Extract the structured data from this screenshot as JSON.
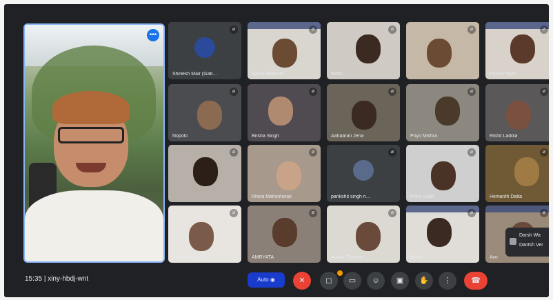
{
  "meeting": {
    "time": "15:35",
    "separator": "|",
    "code": "xiny-hbdj-wnt"
  },
  "speaker": {
    "name": "",
    "badge": "•••"
  },
  "tiles": [
    {
      "label": "Shiriesh Mair (Gab…",
      "type": "avatar",
      "avatar_color": "#2c4a9a",
      "bg": "#3c4043"
    },
    {
      "label": "Darsh Walunat",
      "type": "video",
      "bg": "#d9d6d0",
      "face": "#6b4b34",
      "banner": true
    },
    {
      "label": "ROIC",
      "type": "video",
      "bg": "#cfcac3",
      "face": "#3a2a22"
    },
    {
      "label": "",
      "type": "video",
      "bg": "#c6b8a6",
      "face": "#6b4b34"
    },
    {
      "label": "Prisha Tayal",
      "type": "video",
      "bg": "#d8d2cb",
      "face": "#5b3a2c",
      "banner": true
    },
    {
      "label": "Nopolo",
      "type": "video",
      "bg": "#4a4c4f",
      "face": "#8b6a52"
    },
    {
      "label": "Brisha Singh",
      "type": "video",
      "bg": "#4f4b50",
      "face": "#b08a70"
    },
    {
      "label": "Aahaaran Jena",
      "type": "video",
      "bg": "#6b6459",
      "face": "#3a2a22"
    },
    {
      "label": "Priyo Mishra",
      "type": "video",
      "bg": "#8c8880",
      "face": "#4a3a2c"
    },
    {
      "label": "Rishit Ladola",
      "type": "video",
      "bg": "#5a5858",
      "face": "#7a5040"
    },
    {
      "label": "",
      "type": "video",
      "bg": "#b7b0a8",
      "face": "#2c1f18"
    },
    {
      "label": "Rheia Maheshwari",
      "type": "video",
      "bg": "#a79a8d",
      "face": "#c9a387"
    },
    {
      "label": "parikshit singh ri…",
      "type": "avatar",
      "avatar_color": "#5a6a8a",
      "bg": "#3c4043"
    },
    {
      "label": "Prem Shah",
      "type": "video",
      "bg": "#cfcfcf",
      "face": "#4a3326"
    },
    {
      "label": "Hemanth Datta",
      "type": "video",
      "bg": "#6f5a35",
      "face": "#a07a44"
    },
    {
      "label": "Aaryan Nagpal",
      "type": "video",
      "bg": "#e8e4df",
      "face": "#7a5a48"
    },
    {
      "label": "AMRYATA",
      "type": "video",
      "bg": "#8a8078",
      "face": "#5a3c2c"
    },
    {
      "label": "Anvita Sharma",
      "type": "video",
      "bg": "#dcd8d2",
      "face": "#6a4a3a"
    },
    {
      "label": "Niveo",
      "type": "video",
      "bg": "#e0ddd8",
      "face": "#3a2a22",
      "banner": true
    },
    {
      "label": "Avn",
      "type": "video",
      "bg": "#9a8a7a",
      "face": "#6a4a3a",
      "banner": true
    }
  ],
  "popup": {
    "line1": "Darsh Wa",
    "line2": "Dantsh Ver"
  },
  "controls": {
    "auto_label": "Auto ◉",
    "mic": "✕",
    "camera": "◻",
    "captions": "▭",
    "emoji": "☺",
    "present": "▣",
    "hand": "✋",
    "more": "⋮",
    "leave": "☎"
  }
}
